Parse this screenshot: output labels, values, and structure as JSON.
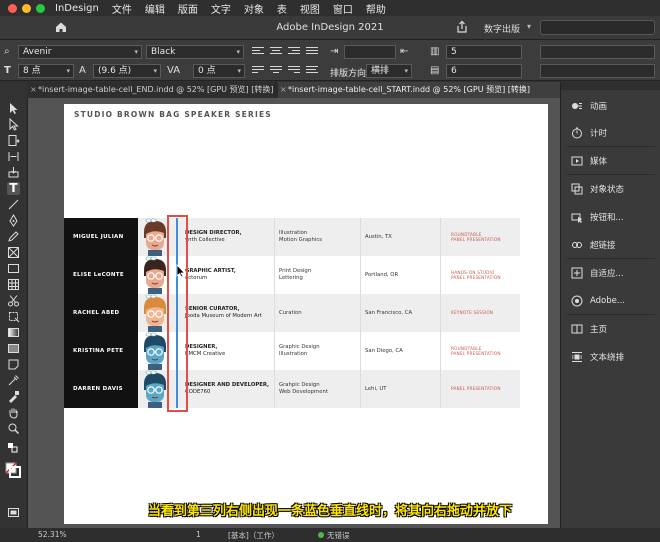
{
  "menubar": {
    "app_menu": "InDesign",
    "items": [
      "文件",
      "编辑",
      "版面",
      "文字",
      "对象",
      "表",
      "视图",
      "窗口",
      "帮助"
    ]
  },
  "appbar": {
    "title": "Adobe InDesign 2021",
    "workspace": "数字出版"
  },
  "control": {
    "font_family": "Avenir",
    "font_style": "Black",
    "font_size": "8 点",
    "leading": "(9.6 点)",
    "tracking": "0 点",
    "columns_value": "5",
    "rows_value": "6",
    "text_direction_label": "排版方向",
    "text_direction_value": "横排"
  },
  "tabs": [
    {
      "label": "*insert-image-table-cell_END.indd @ 52% [GPU 预览] [转换]",
      "active": false
    },
    {
      "label": "*insert-image-table-cell_START.indd @ 52% [GPU 预览] [转换]",
      "active": true
    }
  ],
  "document": {
    "header": "STUDIO BROWN BAG SPEAKER SERIES",
    "rows": [
      {
        "name": "MIGUEL JULIAN",
        "title_bold": "DESIGN DIRECTOR,",
        "title_rest": "ynth Collective",
        "topics": [
          "Illustration",
          "Motion Graphics"
        ],
        "location": "Austin, TX",
        "session": [
          "ROUNDTABLE",
          "PANEL PRESENTATION"
        ],
        "hair": "#6b3b2a",
        "skin": "#e9a98e"
      },
      {
        "name": "ELISE LeCONTE",
        "title_bold": "GRAPHIC ARTIST,",
        "title_rest": "ectorum",
        "topics": [
          "Print Design",
          "Lettering"
        ],
        "location": "Portland, OR",
        "session": [
          "HANDS-ON STUDIO",
          "PANEL PRESENTATION"
        ],
        "hair": "#3a2420",
        "skin": "#e9a98e"
      },
      {
        "name": "RACHEL ABED",
        "title_bold": "SENIOR CURATOR,",
        "title_rest": "Jboda Museum of Modern Art",
        "topics": [
          "Curation"
        ],
        "location": "San Francisco, CA",
        "session": [
          "KEYNOTE SESSION"
        ],
        "hair": "#d98a3a",
        "skin": "#efb58f"
      },
      {
        "name": "KRISTINA PETE",
        "title_bold": "DESIGNER,",
        "title_rest": "KMCM Creative",
        "topics": [
          "Graphic Design",
          "Illustration"
        ],
        "location": "San Diego, CA",
        "session": [
          "ROUNDTABLE",
          "PANEL PRESENTATION"
        ],
        "hair": "#1f4a66",
        "skin": "#5aa7c7"
      },
      {
        "name": "DARREN DAVIS",
        "title_bold": "DESIGNER AND DEVELOPER,",
        "title_rest": "CODE760",
        "topics": [
          "Grahpic Design",
          "Web Development"
        ],
        "location": "Lehi, UT",
        "session": [
          "PANEL PRESENTATION"
        ],
        "hair": "#1f4a66",
        "skin": "#5aa7c7"
      }
    ]
  },
  "panels": [
    "动画",
    "计时",
    "媒体",
    "对象状态",
    "按钮和...",
    "超链接",
    "自适应...",
    "Adobe...",
    "主页",
    "文本绕排"
  ],
  "status": {
    "zoom": "52.31%",
    "page": "1",
    "profile": "[基本]（工作）",
    "preflight": "无错误"
  },
  "subtitle": "当看到第三列右侧出现一条蓝色垂直线时，将其向右拖动并放下",
  "colors": {
    "accent_red": "#e14f44",
    "guide_blue": "#3b8fe0",
    "subtitle_yellow": "#ffe600",
    "session_red": "#c85a4a"
  }
}
